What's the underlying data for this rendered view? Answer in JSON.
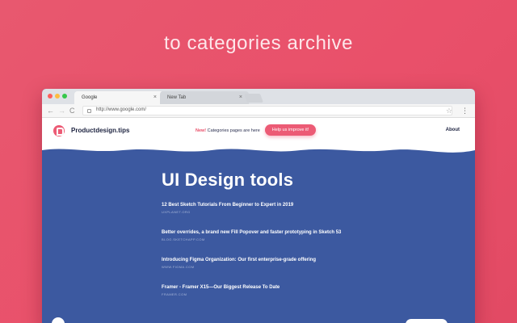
{
  "caption": "to categories archive",
  "browser": {
    "tabs": [
      {
        "label": "Google",
        "close": "×"
      },
      {
        "label": "New Tab",
        "close": "×"
      }
    ],
    "url": "http://www.google.com/",
    "nav": {
      "back": "←",
      "forward": "→",
      "reload": "C"
    },
    "star": "☆",
    "menu": "⋮"
  },
  "site": {
    "brand": "Productdesign.tips",
    "notice_new": "New!",
    "notice_text": " Categories pages are here",
    "improve_label": "Help us improve it!",
    "about_label": "About"
  },
  "section": {
    "title": "UI Design tools",
    "articles": [
      {
        "title": "12 Best Sketch Tutorials From Beginner to Expert in 2019",
        "source": "UXPLANET.ORG"
      },
      {
        "title": "Better overrides, a brand new Fill Popover and faster prototyping in Sketch 53",
        "source": "BLOG.SKETCHAPP.COM"
      },
      {
        "title": "Introducing Figma Organization: Our first enterprise-grade offering",
        "source": "WWW.FIGMA.COM"
      },
      {
        "title": "Framer - Framer X15—Our Biggest Release To Date",
        "source": "FRAMER.COM"
      }
    ]
  },
  "colors": {
    "background": "#e9506a",
    "accent": "#ec5b75",
    "content_blue": "#3c59a0"
  }
}
